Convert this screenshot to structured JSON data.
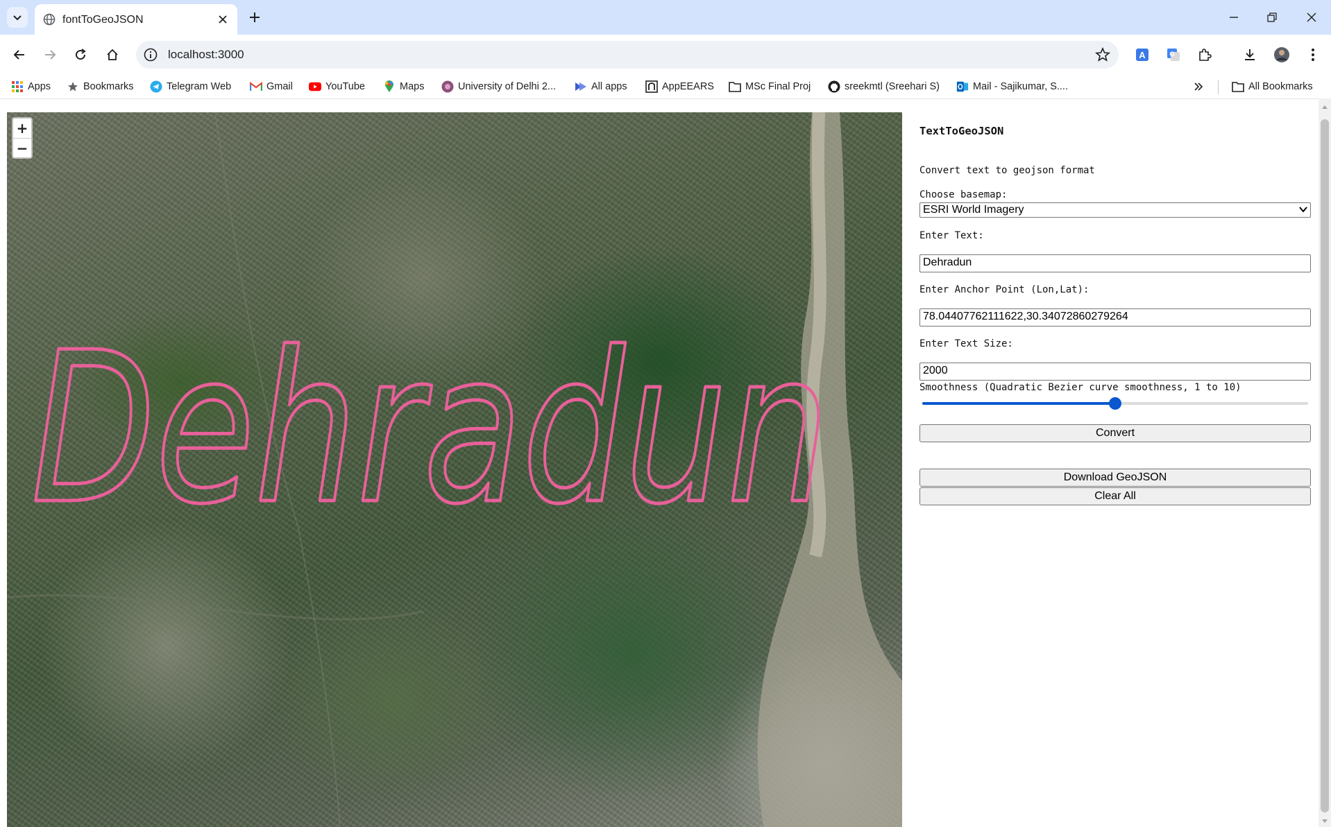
{
  "browser": {
    "tab_title": "fontToGeoJSON",
    "url": "localhost:3000",
    "bookmarks": [
      {
        "label": "Apps",
        "icon": "apps-grid-icon"
      },
      {
        "label": "Bookmarks",
        "icon": "star-icon"
      },
      {
        "label": "Telegram Web",
        "icon": "telegram-icon"
      },
      {
        "label": "Gmail",
        "icon": "gmail-icon"
      },
      {
        "label": "YouTube",
        "icon": "youtube-icon"
      },
      {
        "label": "Maps",
        "icon": "maps-pin-icon"
      },
      {
        "label": "University of Delhi 2...",
        "icon": "university-icon"
      },
      {
        "label": "All apps",
        "icon": "power-apps-icon"
      },
      {
        "label": "AppEEARS",
        "icon": "appeears-icon"
      },
      {
        "label": "MSc Final Proj",
        "icon": "folder-icon"
      },
      {
        "label": "sreekmtl (Sreehari S)",
        "icon": "github-icon"
      },
      {
        "label": "Mail - Sajikumar, S....",
        "icon": "outlook-icon"
      }
    ],
    "all_bookmarks_label": "All Bookmarks"
  },
  "map": {
    "rendered_text": "Dehradun",
    "stroke_color": "#e8609a",
    "zoom_in": "+",
    "zoom_out": "−"
  },
  "panel": {
    "title": "TextToGeoJSON",
    "subtitle": "Convert text to geojson format",
    "basemap_label": "Choose basemap:",
    "basemap_value": "ESRI World Imagery",
    "text_label": "Enter Text:",
    "text_value": "Dehradun",
    "anchor_label": "Enter Anchor Point (Lon,Lat):",
    "anchor_value": "78.04407762111622,30.34072860279264",
    "size_label": "Enter Text Size:",
    "size_value": "2000",
    "smoothness_label": "Smoothness (Quadratic Bezier curve smoothness, 1 to 10)",
    "smoothness_value": 5.5,
    "smoothness_min": 1,
    "smoothness_max": 10,
    "convert_label": "Convert",
    "download_label": "Download GeoJSON",
    "clear_label": "Clear All"
  },
  "colors": {
    "tabbar_bg": "#d3e3fd",
    "accent": "#0b57d0"
  }
}
